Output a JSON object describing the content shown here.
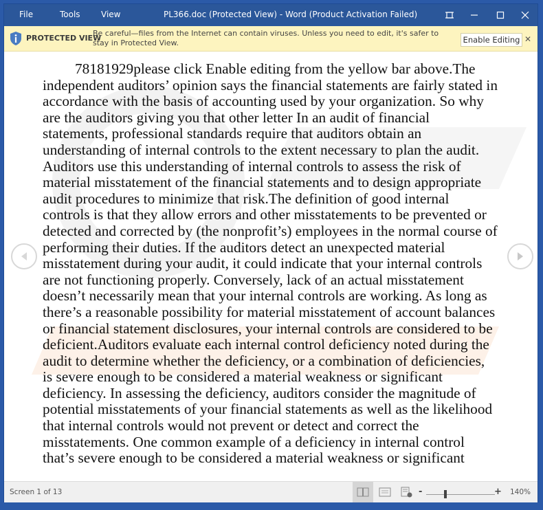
{
  "titlebar": {
    "menu": [
      "File",
      "Tools",
      "View"
    ],
    "title": "PL366.doc (Protected View) - Word (Product Activation Failed)",
    "buttons": [
      "focus-mode",
      "minimize",
      "maximize",
      "close"
    ]
  },
  "protected_view": {
    "label": "PROTECTED VIEW",
    "message": "Be careful—files from the Internet can contain viruses. Unless you need to edit, it's safer to stay in Protected View.",
    "enable_button": "Enable Editing",
    "close_glyph": "✕"
  },
  "document": {
    "text": "78181929please click Enable editing from the yellow bar above.The independent auditors’ opinion says the financial statements are fairly stated in accordance with the basis of accounting used by your organization. So why are the auditors giving you that other letter In an audit of financial statements, professional standards require that auditors obtain an understanding of internal controls to the extent necessary to plan the audit. Auditors use this understanding of internal controls to assess the risk of material misstatement of the financial statements and to design appropriate audit procedures to minimize that risk.The definition of good internal controls is that they allow errors and other misstatements to be prevented or detected and corrected by (the nonprofit’s) employees in the normal course of performing their duties. If the auditors detect an unexpected material misstatement during your audit, it could indicate that your internal controls are not functioning properly. Conversely, lack of an actual misstatement doesn’t necessarily mean that your internal controls are working. As long as there’s a reasonable possibility for material misstatement of account balances or financial statement disclosures, your internal controls are considered to be deficient.Auditors evaluate each internal control deficiency noted during the audit to determine whether the deficiency, or a combination of deficiencies, is severe enough to be considered a material weakness or significant deficiency. In assessing the deficiency, auditors consider the magnitude of potential misstatements of your financial statements as well as the likelihood that internal controls would not prevent or detect and correct the misstatements. One common example of a deficiency in internal control that’s severe enough to be considered a material weakness or significant"
  },
  "statusbar": {
    "screen": "Screen 1 of 13",
    "views": [
      "read-mode",
      "print-layout",
      "web-layout"
    ],
    "active_view": "read-mode",
    "zoom_minus": "-",
    "zoom_plus": "+",
    "zoom_level": "140%",
    "zoom_slider_fraction": 0.28
  },
  "colors": {
    "titlebar": "#2b579a",
    "protected_bar": "#fdf4bf",
    "shield": "#4a7cc2"
  }
}
